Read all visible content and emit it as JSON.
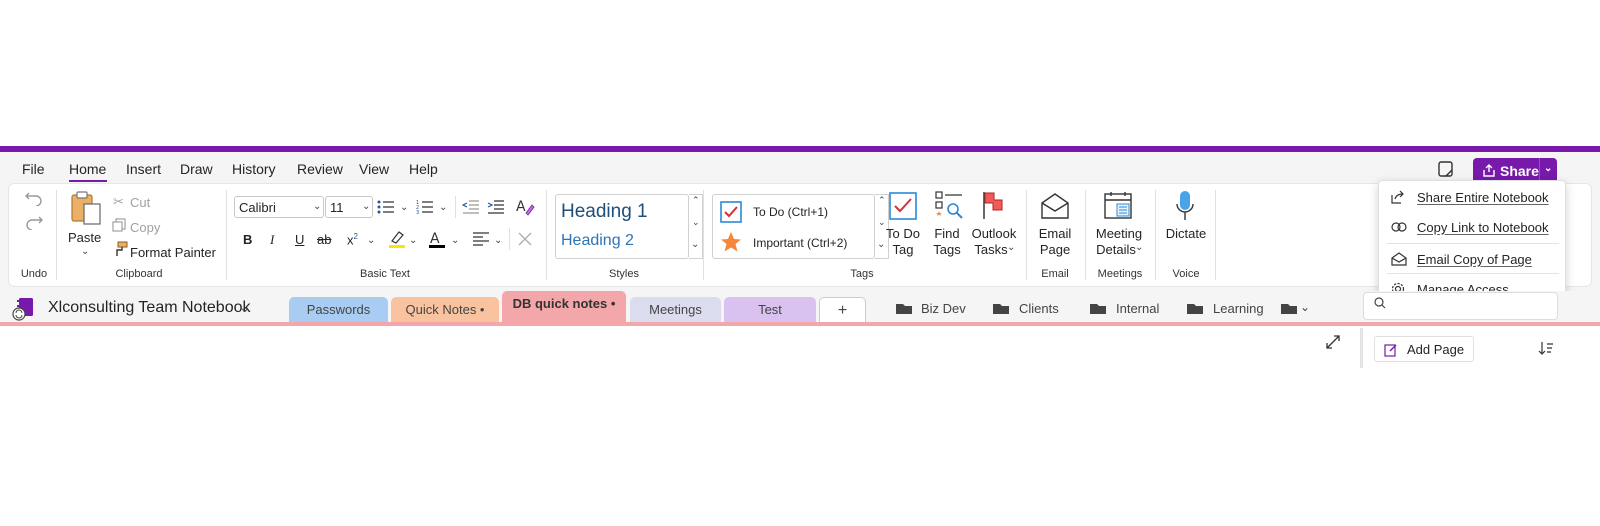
{
  "menu": {
    "items": [
      "File",
      "Home",
      "Insert",
      "Draw",
      "History",
      "Review",
      "View",
      "Help"
    ],
    "active": "Home"
  },
  "share": {
    "label": "Share"
  },
  "share_menu": {
    "items": [
      "Share Entire Notebook",
      "Copy Link to Notebook",
      "Email Copy of Page",
      "Manage Access..."
    ]
  },
  "ribbon": {
    "undo": {
      "label": "Undo"
    },
    "clipboard": {
      "paste": "Paste",
      "cut": "Cut",
      "copy": "Copy",
      "format_painter": "Format Painter",
      "label": "Clipboard"
    },
    "basic_text": {
      "font": "Calibri",
      "size": "11",
      "bold": "B",
      "italic": "I",
      "underline": "U",
      "strike": "ab",
      "superscript": "x",
      "label": "Basic Text"
    },
    "styles": {
      "heading1": "Heading 1",
      "heading2": "Heading 2",
      "label": "Styles"
    },
    "tags": {
      "todo": "To Do (Ctrl+1)",
      "important": "Important (Ctrl+2)",
      "todo_tag_line1": "To Do",
      "todo_tag_line2": "Tag",
      "find_line1": "Find",
      "find_line2": "Tags",
      "outlook_line1": "Outlook",
      "outlook_line2": "Tasks",
      "label": "Tags"
    },
    "email": {
      "line1": "Email",
      "line2": "Page",
      "label": "Email"
    },
    "meetings": {
      "line1": "Meeting",
      "line2": "Details",
      "label": "Meetings"
    },
    "voice": {
      "dictate": "Dictate",
      "label": "Voice"
    }
  },
  "notebook": {
    "title": "Xlconsulting Team Notebook"
  },
  "sections": [
    {
      "label": "Passwords",
      "color": "#a9cdf2"
    },
    {
      "label": "Quick Notes •",
      "color": "#f9c3a0"
    },
    {
      "label": "DB quick notes •",
      "color": "#f3a7aa"
    },
    {
      "label": "Meetings",
      "color": "#dcdcef"
    },
    {
      "label": "Test",
      "color": "#d9c2ef"
    },
    {
      "label": "+",
      "color": "#ffffff"
    }
  ],
  "section_groups": [
    "Biz Dev",
    "Clients",
    "Internal",
    "Learning"
  ],
  "page_list": {
    "add_page": "Add Page"
  },
  "colors": {
    "accent": "#7719aa",
    "active_tab": "#f3a7aa"
  }
}
